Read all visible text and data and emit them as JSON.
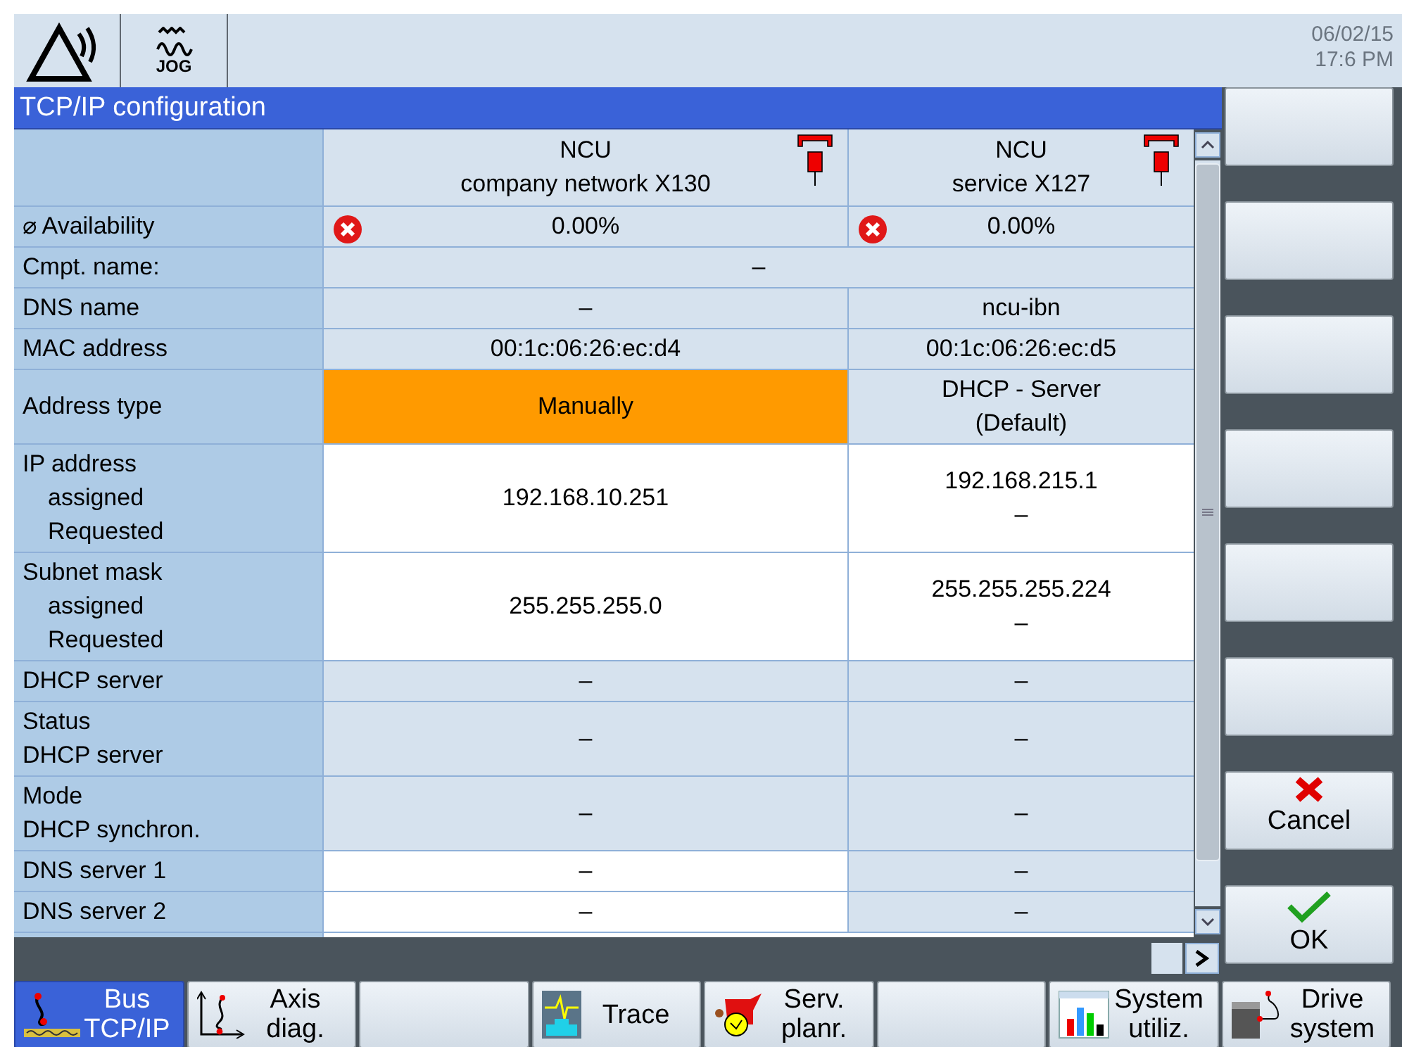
{
  "header": {
    "mode": "JOG",
    "date": "06/02/15",
    "time": "17:6 PM"
  },
  "title": "TCP/IP configuration",
  "columns": [
    {
      "lines": [
        "NCU",
        "company network X130"
      ],
      "unplugged": true
    },
    {
      "lines": [
        "NCU",
        "service X127"
      ],
      "unplugged": true
    }
  ],
  "rows": [
    {
      "label": {
        "lines": [
          "⌀ Availability"
        ]
      },
      "values": [
        {
          "lines": [
            "0.00%"
          ],
          "error": true,
          "editable": false,
          "selected": false
        },
        {
          "lines": [
            "0.00%"
          ],
          "error": true,
          "editable": false,
          "selected": false
        }
      ]
    },
    {
      "label": {
        "lines": [
          "Cmpt. name:"
        ]
      },
      "values": [
        {
          "lines": [
            "–"
          ],
          "editable": false,
          "selected": false
        }
      ]
    },
    {
      "label": {
        "lines": [
          "DNS name"
        ]
      },
      "values": [
        {
          "lines": [
            "–"
          ],
          "editable": false,
          "selected": false
        },
        {
          "lines": [
            "ncu-ibn"
          ],
          "editable": false,
          "selected": false
        }
      ]
    },
    {
      "label": {
        "lines": [
          "MAC address"
        ]
      },
      "values": [
        {
          "lines": [
            "00:1c:06:26:ec:d4"
          ],
          "editable": false,
          "selected": false
        },
        {
          "lines": [
            "00:1c:06:26:ec:d5"
          ],
          "editable": false,
          "selected": false
        }
      ]
    },
    {
      "label": {
        "lines": [
          "Address type"
        ]
      },
      "values": [
        {
          "lines": [
            "Manually"
          ],
          "editable": true,
          "selected": true
        },
        {
          "lines": [
            "DHCP - Server",
            "(Default)"
          ],
          "editable": false,
          "selected": false
        }
      ]
    },
    {
      "label": {
        "lines": [
          "IP address"
        ],
        "sub": [
          "assigned",
          "Requested"
        ]
      },
      "values": [
        {
          "lines": [
            "192.168.10.251"
          ],
          "editable": true,
          "selected": false
        },
        {
          "lines": [
            "192.168.215.1",
            "–"
          ],
          "editable": true,
          "selected": false
        }
      ]
    },
    {
      "label": {
        "lines": [
          "Subnet mask"
        ],
        "sub": [
          "assigned",
          "Requested"
        ]
      },
      "values": [
        {
          "lines": [
            "255.255.255.0"
          ],
          "editable": true,
          "selected": false
        },
        {
          "lines": [
            "255.255.255.224",
            "–"
          ],
          "editable": true,
          "selected": false
        }
      ]
    },
    {
      "label": {
        "lines": [
          "DHCP server"
        ]
      },
      "values": [
        {
          "lines": [
            "–"
          ],
          "editable": false,
          "selected": false
        },
        {
          "lines": [
            "–"
          ],
          "editable": false,
          "selected": false
        }
      ]
    },
    {
      "label": {
        "lines": [
          "Status",
          "DHCP server"
        ]
      },
      "values": [
        {
          "lines": [
            "–"
          ],
          "editable": false,
          "selected": false
        },
        {
          "lines": [
            "–"
          ],
          "editable": false,
          "selected": false
        }
      ]
    },
    {
      "label": {
        "lines": [
          "Mode",
          "DHCP synchron."
        ]
      },
      "values": [
        {
          "lines": [
            "–"
          ],
          "editable": false,
          "selected": false
        },
        {
          "lines": [
            "–"
          ],
          "editable": false,
          "selected": false
        }
      ]
    },
    {
      "label": {
        "lines": [
          "DNS server 1"
        ]
      },
      "values": [
        {
          "lines": [
            "–"
          ],
          "editable": true,
          "selected": false
        },
        {
          "lines": [
            "–"
          ],
          "editable": false,
          "selected": false
        }
      ]
    },
    {
      "label": {
        "lines": [
          "DNS server 2"
        ]
      },
      "values": [
        {
          "lines": [
            "–"
          ],
          "editable": true,
          "selected": false
        },
        {
          "lines": [
            "–"
          ],
          "editable": false,
          "selected": false
        }
      ]
    }
  ],
  "vertical_softkeys": [
    {
      "kind": "empty"
    },
    {
      "kind": "empty"
    },
    {
      "kind": "empty"
    },
    {
      "kind": "empty"
    },
    {
      "kind": "empty"
    },
    {
      "kind": "empty"
    },
    {
      "kind": "cancel",
      "lines": [
        "Cancel"
      ]
    },
    {
      "kind": "ok",
      "lines": [
        "OK"
      ]
    }
  ],
  "horizontal_softkeys": [
    {
      "kind": "bus",
      "lines": [
        "Bus",
        "TCP/IP"
      ],
      "selected": true
    },
    {
      "kind": "axis",
      "lines": [
        "Axis",
        "diag."
      ],
      "selected": false
    },
    {
      "kind": "empty",
      "selected": false
    },
    {
      "kind": "trace",
      "lines": [
        "Trace"
      ],
      "selected": false
    },
    {
      "kind": "service",
      "lines": [
        "Serv.",
        "planr."
      ],
      "selected": false
    },
    {
      "kind": "empty",
      "selected": false
    },
    {
      "kind": "utilization",
      "lines": [
        "System",
        "utiliz."
      ],
      "selected": false
    },
    {
      "kind": "drive",
      "lines": [
        "Drive",
        "system"
      ],
      "selected": false
    }
  ]
}
